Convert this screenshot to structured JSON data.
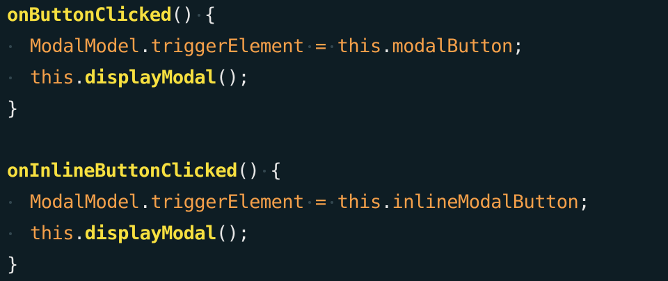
{
  "colors": {
    "background": "#0e1d24",
    "function": "#f7e040",
    "identifier": "#f5a04a",
    "punctuation": "#e6e6e6",
    "whitespace_marker": "#33474f"
  },
  "code": {
    "block1": {
      "fn_name": "onButtonClicked",
      "fn_parens": "()",
      "open_brace": "{",
      "assign_target_obj": "ModalModel",
      "dot": ".",
      "assign_target_prop": "triggerElement",
      "assign_op": "=",
      "this_kw": "this",
      "assign_value": "modalButton",
      "semicolon": ";",
      "call_this": "this",
      "call_method": "displayModal",
      "call_parens": "();",
      "close_brace": "}"
    },
    "block2": {
      "fn_name": "onInlineButtonClicked",
      "fn_parens": "()",
      "open_brace": "{",
      "assign_target_obj": "ModalModel",
      "dot": ".",
      "assign_target_prop": "triggerElement",
      "assign_op": "=",
      "this_kw": "this",
      "assign_value": "inlineModalButton",
      "semicolon": ";",
      "call_this": "this",
      "call_method": "displayModal",
      "call_parens": "();",
      "close_brace": "}"
    }
  }
}
